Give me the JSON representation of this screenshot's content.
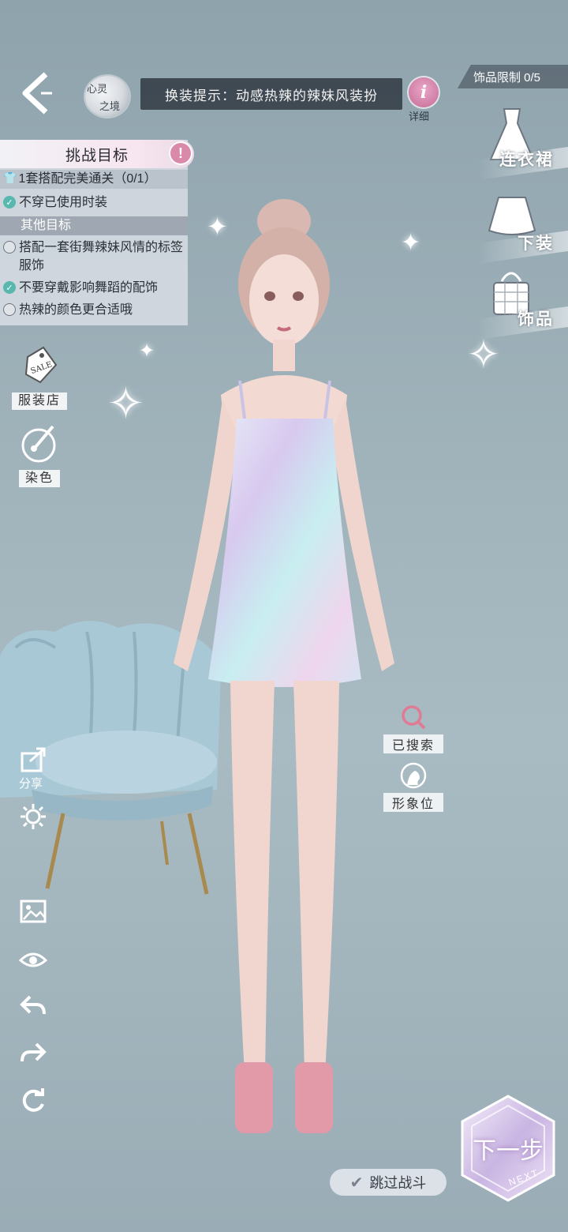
{
  "header": {
    "spirit_badge_line1": "心灵",
    "spirit_badge_line2": "之境",
    "hint": "换装提示：动感热辣的辣妹风装扮",
    "info_label": "详细",
    "accessory_limit": "饰品限制 0/5"
  },
  "challenge": {
    "title": "挑战目标",
    "main_goal": "1套搭配完美通关（0/1）",
    "goals": [
      {
        "text": "不穿已使用时装",
        "done": true
      }
    ],
    "other_title": "其他目标",
    "other_goals": [
      {
        "text": "搭配一套街舞辣妹风情的标签服饰",
        "done": false
      },
      {
        "text": "不要穿戴影响舞蹈的配饰",
        "done": true
      },
      {
        "text": "热辣的颜色更合适哦",
        "done": false
      }
    ]
  },
  "left_menu": {
    "shop_label": "服装店",
    "sale_tag": "SALE",
    "dye_label": "染色",
    "share_label": "分享"
  },
  "categories": [
    {
      "label": "连衣裙",
      "icon": "dress-icon"
    },
    {
      "label": "下装",
      "icon": "skirt-icon"
    },
    {
      "label": "饰品",
      "icon": "bag-icon"
    }
  ],
  "right_tools": {
    "searched_label": "已搜索",
    "image_label": "形象位"
  },
  "footer": {
    "skip_label": "跳过战斗",
    "next_label": "下一步",
    "next_en": "NEXT"
  },
  "colors": {
    "accent_pink": "#d98aa9",
    "check_teal": "#58b8ae",
    "background": "#9fb2ba"
  }
}
